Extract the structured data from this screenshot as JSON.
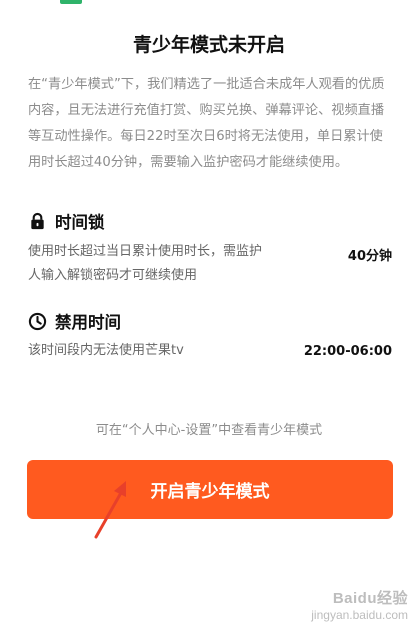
{
  "title": "青少年模式未开启",
  "description": "在“青少年模式”下，我们精选了一批适合未成年人观看的优质内容，且无法进行充值打赏、购买兑换、弹幕评论、视频直播等互动性操作。每日22时至次日6时将无法使用，单日累计使用时长超过40分钟，需要输入监护密码才能继续使用。",
  "time_lock": {
    "icon": "lock-icon",
    "heading": "时间锁",
    "text_line1": "使用时长超过当日累计使用时长，需监护",
    "text_line2": "人输入解锁密码才可继续使用",
    "value": "40分钟"
  },
  "ban_time": {
    "icon": "clock-icon",
    "heading": "禁用时间",
    "text": "该时间段内无法使用芒果tv",
    "value": "22:00-06:00"
  },
  "hint": "可在“个人中心-设置”中查看青少年模式",
  "cta_label": "开启青少年模式",
  "colors": {
    "accent": "#ff5a1f",
    "text_muted": "#8c8c8c"
  },
  "watermark": {
    "brand": "Baidu经验",
    "sub": "jingyan.baidu.com"
  }
}
